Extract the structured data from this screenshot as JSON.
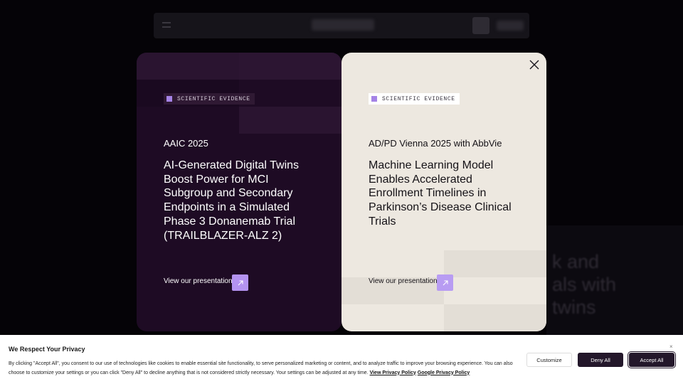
{
  "hero_background": {
    "lines": [
      "k and",
      "als with",
      "twins"
    ]
  },
  "cards": [
    {
      "tag": "SCIENTIFIC EVIDENCE",
      "eyebrow": "AAIC 2025",
      "headline_lines": [
        "AI-Generated Digital Twins",
        "Boost Power for MCI",
        "Subgroup and Secondary",
        "Endpoints in a Simulated",
        "Phase 3 Donanemab Trial",
        "(TRAILBLAZER-ALZ 2)"
      ],
      "link": "View our presentation",
      "arrow_icon": "arrow-up-right-icon"
    },
    {
      "tag": "SCIENTIFIC EVIDENCE",
      "eyebrow": "AD/PD Vienna 2025 with AbbVie",
      "headline_lines": [
        "Machine Learning Model",
        "Enables Accelerated",
        "Enrollment Timelines in",
        "Parkinson’s Disease Clinical",
        "Trials"
      ],
      "link": "View our presentation",
      "arrow_icon": "arrow-up-right-icon",
      "close_icon": "close-icon"
    }
  ],
  "cookie_banner": {
    "title": "We Respect Your Privacy",
    "body_line1": "By clicking \"Accept All\", you consent to our use of technologies like cookies to enable essential site functionality, to serve personalized marketing or content, and to analyze traffic to improve your browsing experience. You can also",
    "body_line2": "choose to customize your settings or you can click \"Deny All\" to decline anything that is not considered strictly necessary. Your settings can be adjusted at any time.",
    "link_view_privacy": "View Privacy Policy",
    "link_google_privacy": "Google Privacy Policy",
    "close": "×",
    "buttons": {
      "customize": "Customize",
      "deny": "Deny All",
      "accept": "Accept All"
    }
  },
  "colors": {
    "left_card_bg": "#1e0b24",
    "right_card_bg": "#ede8e0",
    "accent_purple": "#b493f0",
    "banner_button_dark": "#23172a"
  }
}
